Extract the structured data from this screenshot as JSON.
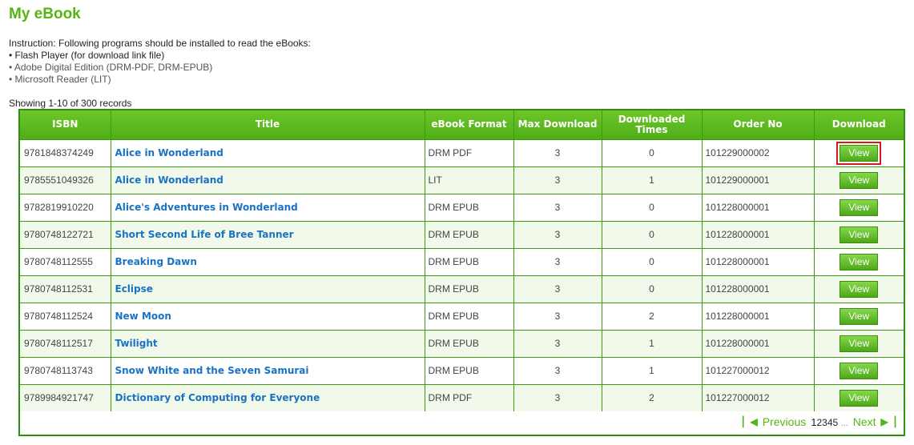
{
  "page": {
    "title": "My eBook",
    "instruction": "Instruction: Following programs should be installed to read the eBooks:",
    "requirements": [
      "• Flash Player (for download link file)",
      "• Adobe Digital Edition (DRM-PDF, DRM-EPUB)",
      "• Microsoft Reader (LIT)"
    ],
    "showing": "Showing 1-10 of 300 records"
  },
  "table": {
    "headers": {
      "isbn": "ISBN",
      "title": "Title",
      "format": "eBook Format",
      "max_download": "Max Download",
      "downloaded_times": "Downloaded Times",
      "order_no": "Order No",
      "download": "Download"
    },
    "rows": [
      {
        "isbn": "9781848374249",
        "title": "Alice in Wonderland",
        "format": "DRM PDF",
        "max": "3",
        "downloaded": "0",
        "order": "101229000002",
        "action": "View"
      },
      {
        "isbn": "9785551049326",
        "title": "Alice in Wonderland",
        "format": "LIT",
        "max": "3",
        "downloaded": "1",
        "order": "101229000001",
        "action": "View"
      },
      {
        "isbn": "9782819910220",
        "title": "Alice's Adventures in Wonderland",
        "format": "DRM EPUB",
        "max": "3",
        "downloaded": "0",
        "order": "101228000001",
        "action": "View"
      },
      {
        "isbn": "9780748122721",
        "title": "Short Second Life of Bree Tanner",
        "format": "DRM EPUB",
        "max": "3",
        "downloaded": "0",
        "order": "101228000001",
        "action": "View"
      },
      {
        "isbn": "9780748112555",
        "title": "Breaking Dawn",
        "format": "DRM EPUB",
        "max": "3",
        "downloaded": "0",
        "order": "101228000001",
        "action": "View"
      },
      {
        "isbn": "9780748112531",
        "title": "Eclipse",
        "format": "DRM EPUB",
        "max": "3",
        "downloaded": "0",
        "order": "101228000001",
        "action": "View"
      },
      {
        "isbn": "9780748112524",
        "title": "New Moon",
        "format": "DRM EPUB",
        "max": "3",
        "downloaded": "2",
        "order": "101228000001",
        "action": "View"
      },
      {
        "isbn": "9780748112517",
        "title": "Twilight",
        "format": "DRM EPUB",
        "max": "3",
        "downloaded": "1",
        "order": "101228000001",
        "action": "View"
      },
      {
        "isbn": "9780748113743",
        "title": "Snow White and the Seven Samurai",
        "format": "DRM EPUB",
        "max": "3",
        "downloaded": "1",
        "order": "101227000012",
        "action": "View"
      },
      {
        "isbn": "9789984921747",
        "title": "Dictionary of Computing for Everyone",
        "format": "DRM PDF",
        "max": "3",
        "downloaded": "2",
        "order": "101227000012",
        "action": "View"
      }
    ]
  },
  "pagination": {
    "first_icon": "first-page-icon",
    "prev_label": "Previous",
    "pages": [
      "1",
      "2",
      "3",
      "4",
      "5"
    ],
    "ellipsis": "...",
    "next_label": "Next",
    "last_icon": "last-page-icon"
  },
  "colors": {
    "accent": "#57b512",
    "header_bg": "#5bb81f",
    "link": "#1a72c4",
    "highlight": "#d61a1a"
  }
}
